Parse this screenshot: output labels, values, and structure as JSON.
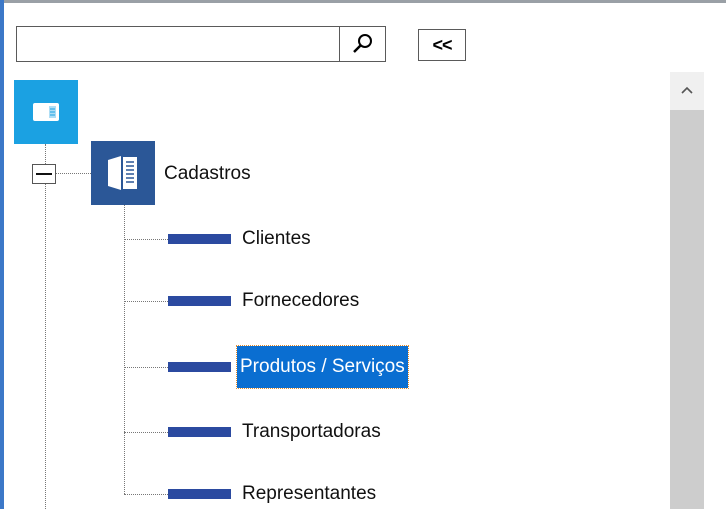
{
  "search": {
    "value": "",
    "placeholder": ""
  },
  "toolbar": {
    "collapse_label": "<<"
  },
  "tree": {
    "root": {
      "icon": "module-icon",
      "color": "#1ba1e2"
    },
    "group": {
      "label": "Cadastros",
      "icon": "book-icon",
      "color": "#2b5797",
      "expanded": true,
      "children": [
        {
          "label": "Clientes",
          "selected": false
        },
        {
          "label": "Fornecedores",
          "selected": false
        },
        {
          "label": "Produtos / Serviços",
          "selected": true
        },
        {
          "label": "Transportadoras",
          "selected": false
        },
        {
          "label": "Representantes",
          "selected": false
        }
      ]
    }
  },
  "colors": {
    "accent": "#1ba1e2",
    "group_tile": "#2b5797",
    "child_bar": "#2b4aa0",
    "selection": "#0a6ed1"
  }
}
